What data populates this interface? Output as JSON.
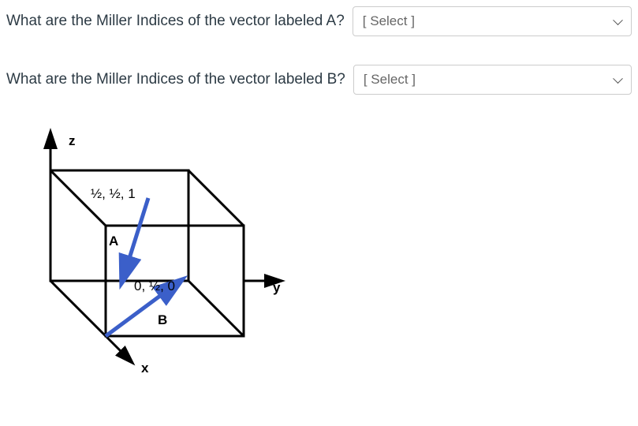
{
  "questions": {
    "a": {
      "text": "What are the Miller Indices of the vector labeled A?",
      "select_placeholder": "[ Select ]"
    },
    "b": {
      "text": "What are the Miller Indices of the vector labeled B?",
      "select_placeholder": "[ Select ]"
    }
  },
  "figure": {
    "axes": {
      "x": "x",
      "y": "y",
      "z": "z"
    },
    "vectors": {
      "a_label": "A",
      "b_label": "B"
    },
    "points": {
      "top_point": "½, ½, 1",
      "mid_point": "0, ½, 0"
    }
  }
}
